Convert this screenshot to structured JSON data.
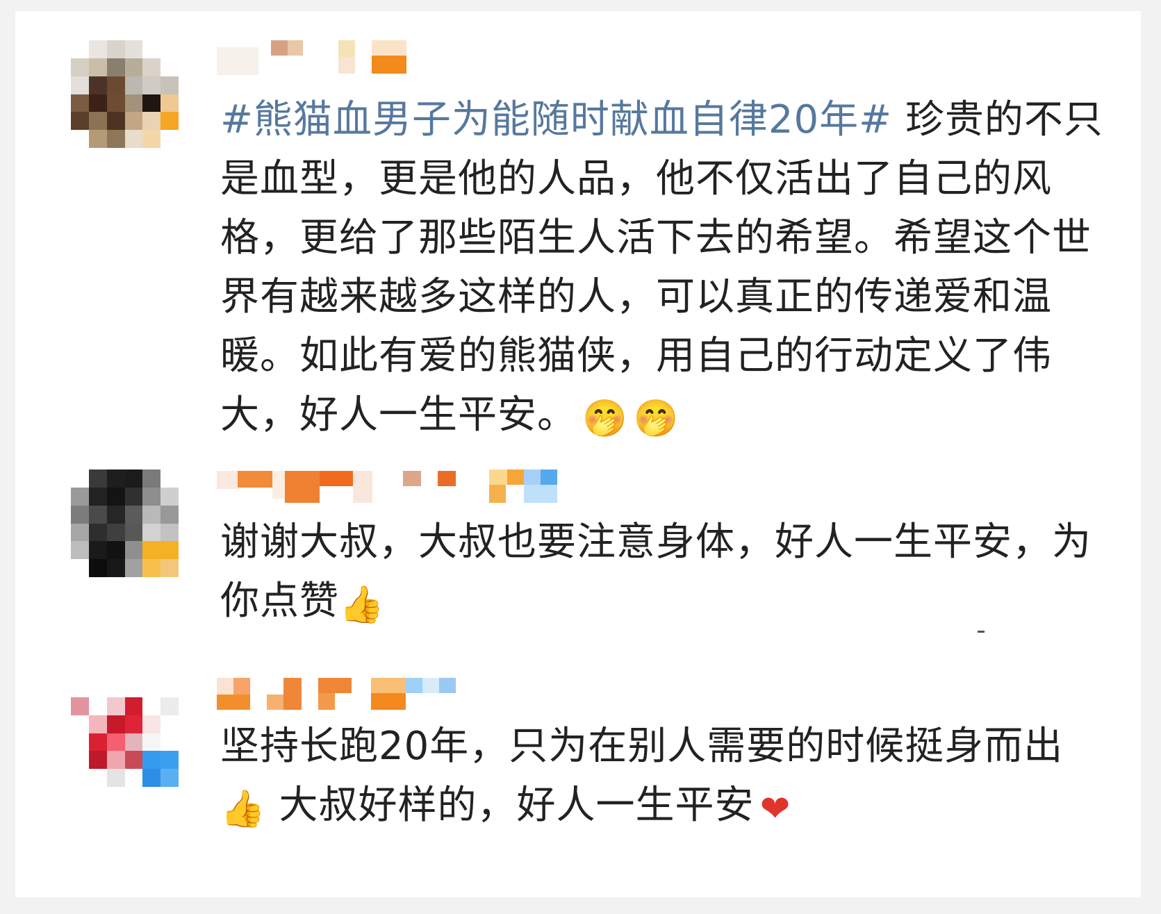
{
  "comments": [
    {
      "hashtag": "#熊猫血男子为能随时献血自律20年#",
      "text": " 珍贵的不只是血型，更是他的人品，他不仅活出了自己的风格，更给了那些陌生人活下去的希望。希望这个世界有越来越多这样的人，可以真正的传递爱和温暖。如此有爱的熊猫侠，用自己的行动定义了伟大，好人一生平安。",
      "emojis": [
        "🤭",
        "🤭"
      ]
    },
    {
      "text": "谢谢大叔，大叔也要注意身体，好人一生平安，为你点赞",
      "emojis": [
        "👍"
      ]
    },
    {
      "text": "坚持长跑20年，只为在别人需要的时候挺身而出",
      "emoji_inline": "👍",
      "text2": " 大叔好样的，好人一生平安",
      "emojis": [
        "❤"
      ]
    }
  ],
  "colors": {
    "hashtag": "#56789f",
    "text": "#222222",
    "heart": "#e0352b"
  }
}
